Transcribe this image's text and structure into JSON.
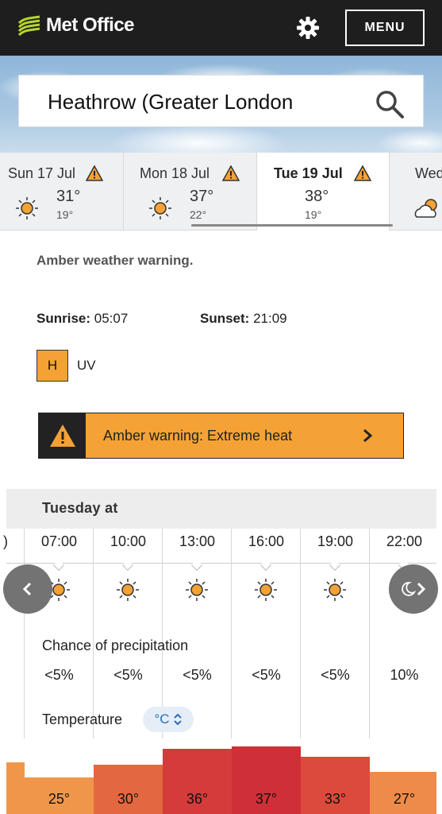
{
  "header": {
    "logo_text": "Met Office",
    "menu_label": "MENU",
    "icons": {
      "logo": "met-office-logo-icon",
      "settings": "gear-icon"
    }
  },
  "search": {
    "value": "Heathrow (Greater London",
    "icon": "search-icon"
  },
  "days": [
    {
      "label": "Sun 17 Jul",
      "high": "31°",
      "low": "19°",
      "warning": true,
      "icon": "sun-icon",
      "selected": false
    },
    {
      "label": "Mon 18 Jul",
      "high": "37°",
      "low": "22°",
      "warning": true,
      "icon": "sun-icon",
      "selected": false
    },
    {
      "label": "Tue 19 Jul",
      "high": "38°",
      "low": "19°",
      "warning": true,
      "icon": "sun-icon",
      "selected": true
    },
    {
      "label": "Wed",
      "icon": "sun-cloud-icon",
      "selected": false
    }
  ],
  "info": {
    "amber_text": "Amber weather warning.",
    "sunrise_label": "Sunrise:",
    "sunrise_value": "05:07",
    "sunset_label": "Sunset:",
    "sunset_value": "21:09",
    "uv_level": "H",
    "uv_label": "UV"
  },
  "warning_banner": {
    "text": "Amber warning: Extreme heat",
    "color": "#f4a236"
  },
  "hourly": {
    "title": "Tuesday at",
    "partial_label": ")",
    "times": [
      "07:00",
      "10:00",
      "13:00",
      "16:00",
      "19:00",
      "22:00"
    ],
    "icons": [
      "sun-icon",
      "sun-icon",
      "sun-icon",
      "sun-icon",
      "sun-icon",
      "moon-icon"
    ],
    "precip_title": "Chance of precipitation",
    "precip": [
      "<5%",
      "<5%",
      "<5%",
      "<5%",
      "<5%",
      "10%"
    ],
    "temp_title": "Temperature",
    "unit": "°C",
    "temps": [
      "25°",
      "30°",
      "36°",
      "37°",
      "33°",
      "27°"
    ],
    "temp_values": [
      25,
      30,
      36,
      37,
      33,
      27
    ],
    "temp_colors": [
      "#f0964a",
      "#e4683f",
      "#d43b3b",
      "#cf2f36",
      "#dc4a3c",
      "#ee8a4a"
    ]
  },
  "colors": {
    "header_bg": "#1e1e1e",
    "amber": "#f4a236",
    "accent_blue": "#2a6fb8"
  }
}
